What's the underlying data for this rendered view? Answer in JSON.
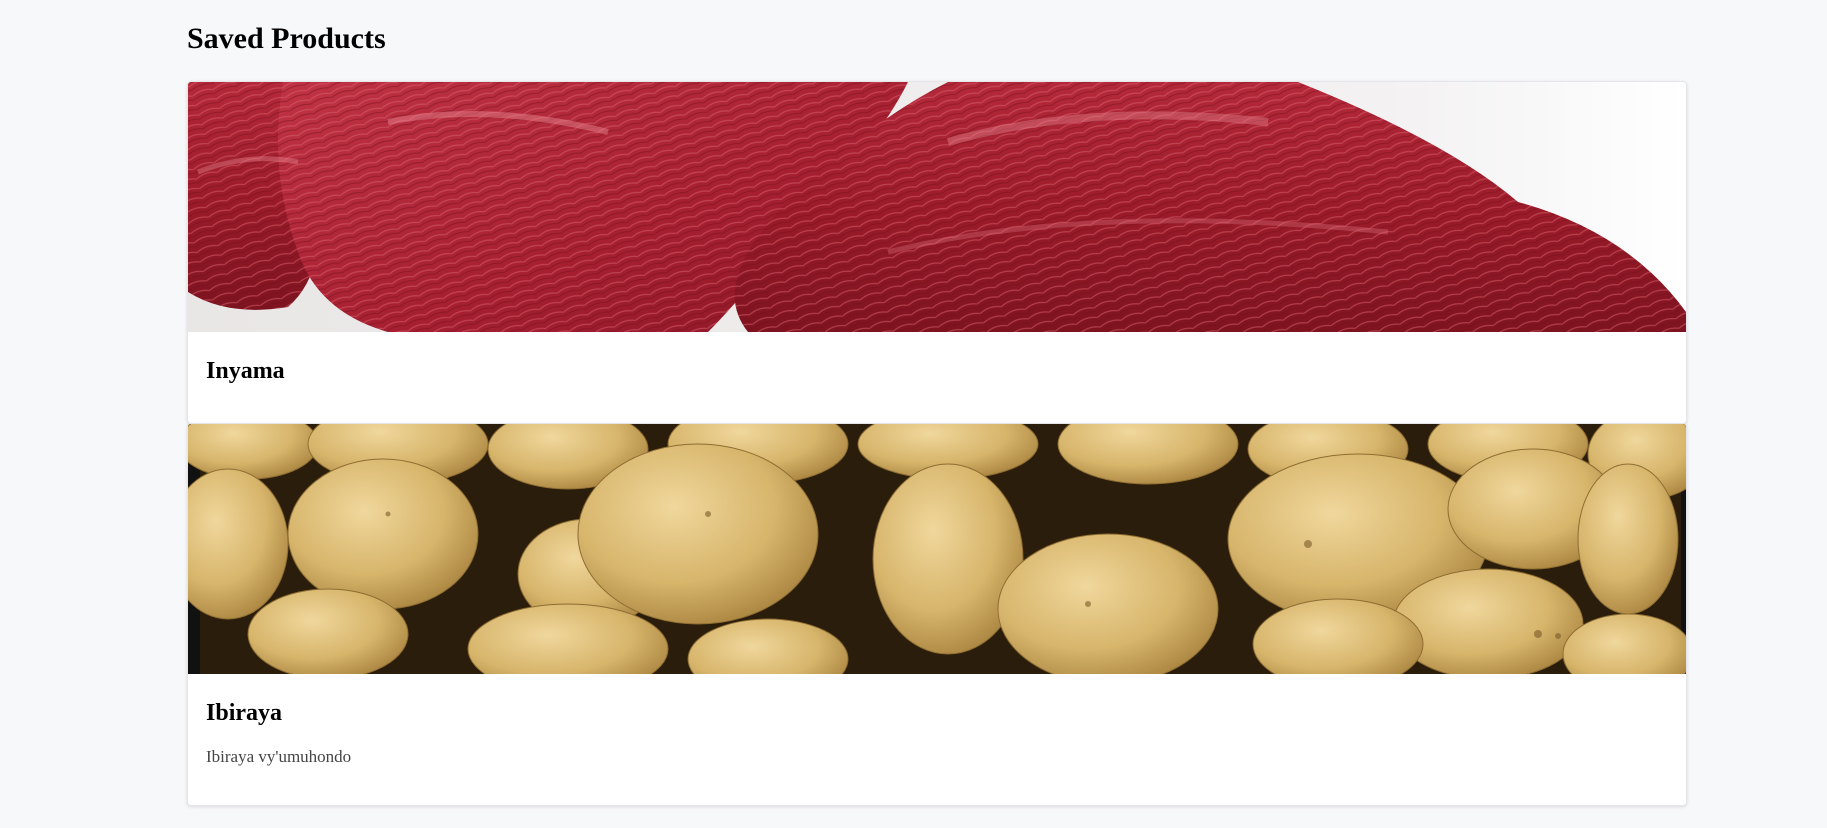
{
  "page": {
    "title": "Saved Products"
  },
  "products": [
    {
      "name": "Inyama",
      "description": "",
      "image_subject": "raw-meat-image"
    },
    {
      "name": "Ibiraya",
      "description": "Ibiraya vy'umuhondo",
      "image_subject": "potatoes-image"
    }
  ],
  "colors": {
    "background": "#f7f8fa",
    "card": "#ffffff",
    "meat": "#a3202e",
    "potato": "#d8b96e"
  }
}
